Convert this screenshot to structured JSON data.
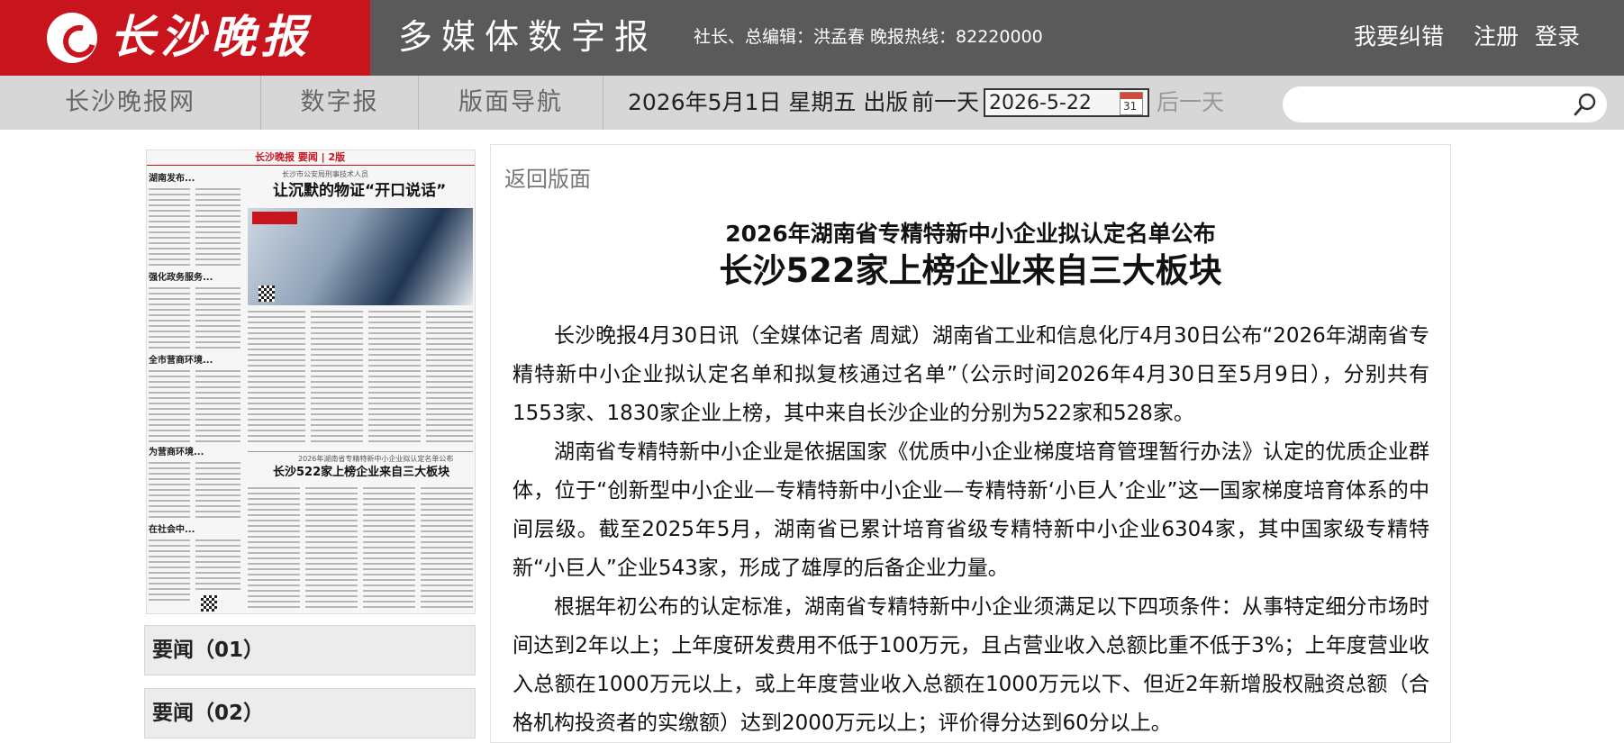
{
  "header": {
    "logo_text": "长沙晚报",
    "site_subtitle": "多媒体数字报",
    "editor_info": "社长、总编辑：洪孟春 晚报热线：82220000",
    "report_error_link": "我要纠错",
    "register_link": "注册",
    "login_link": "登录"
  },
  "nav": {
    "items": [
      {
        "label": "长沙晚报网"
      },
      {
        "label": "数字报"
      },
      {
        "label": "版面导航"
      }
    ],
    "issue_date": "2026年5月1日 星期五 出版",
    "prev_day": "前一天",
    "date_value": "2026-5-22",
    "next_day": "后一天",
    "search_placeholder": ""
  },
  "thumbnail": {
    "masthead": "长沙晚报  要闻 | 2版",
    "headline_top": "让沉默的物证“开口说话”",
    "headline_top_kicker": "长沙市公安局刑事技术人员",
    "headline_mid_kicker": "2026年湖南省专精特新中小企业拟认定名单公布",
    "headline_mid": "长沙522家上榜企业来自三大板块",
    "side_headings": [
      "湖南发布...",
      "强化政务服务...",
      "全市营商环境...",
      "为营商环境...",
      "在社会中..."
    ]
  },
  "sections": [
    {
      "label": "要闻（01）"
    },
    {
      "label": "要闻（02）"
    }
  ],
  "article": {
    "back_link": "返回版面",
    "subtitle": "2026年湖南省专精特新中小企业拟认定名单公布",
    "headline": "长沙522家上榜企业来自三大板块",
    "paragraphs": [
      "长沙晚报4月30日讯（全媒体记者 周斌）湖南省工业和信息化厅4月30日公布“2026年湖南省专精特新中小企业拟认定名单和拟复核通过名单”（公示时间2026年4月30日至5月9日），分别共有1553家、1830家企业上榜，其中来自长沙企业的分别为522家和528家。",
      "湖南省专精特新中小企业是依据国家《优质中小企业梯度培育管理暂行办法》认定的优质企业群体，位于“创新型中小企业—专精特新中小企业—专精特新‘小巨人’企业”这一国家梯度培育体系的中间层级。截至2025年5月，湖南省已累计培育省级专精特新中小企业6304家，其中国家级专精特新“小巨人”企业543家，形成了雄厚的后备企业力量。",
      "根据年初公布的认定标准，湖南省专精特新中小企业须满足以下四项条件：从事特定细分市场时间达到2年以上；上年度研发费用不低于100万元，且占营业收入总额比重不低于3%；上年度营业收入总额在1000万元以上，或上年度营业收入总额在1000万元以下、但近2年新增股权融资总额（合格机构投资者的实缴额）达到2000万元以上；评价得分达到60分以上。"
    ]
  },
  "colors": {
    "brand_red": "#c8151d",
    "topbar_gray": "#5a5a5a",
    "navbar_gray": "#d7d7d7"
  }
}
